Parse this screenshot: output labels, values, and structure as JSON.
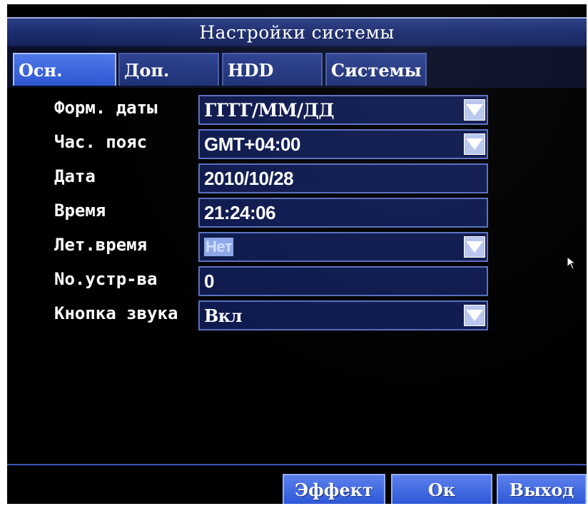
{
  "window": {
    "title": "Настройки системы"
  },
  "tabs": [
    {
      "label": "Осн.",
      "active": true
    },
    {
      "label": "Доп.",
      "active": false
    },
    {
      "label": "HDD",
      "active": false
    },
    {
      "label": "Системы",
      "active": false
    }
  ],
  "settings": {
    "date_format": {
      "label": "Форм. даты",
      "value": "ГГГГ/ММ/ДД"
    },
    "timezone": {
      "label": "Час. пояс",
      "value": "GMT+04:00"
    },
    "date": {
      "label": "Дата",
      "value": "2010/10/28"
    },
    "time": {
      "label": "Время",
      "value": "21:24:06"
    },
    "dst": {
      "label": "Лет.время",
      "value": "Нет"
    },
    "device_no": {
      "label": "No.устр-ва",
      "value": "0"
    },
    "key_sound": {
      "label": "Кнопка звука",
      "value": "Вкл"
    }
  },
  "buttons": {
    "effect": "Эффект",
    "ok": "Ок",
    "exit": "Выход"
  },
  "icons": {
    "dropdown": "chevron-down-icon",
    "pointer": "mouse-cursor-icon"
  },
  "colors": {
    "background": "#000000",
    "titlebar": "#1c2c6e",
    "tab_active": "#3d66e0",
    "field_bg": "#0e1a4e",
    "field_border": "#5a6fbf",
    "button": "#3d66e0"
  }
}
